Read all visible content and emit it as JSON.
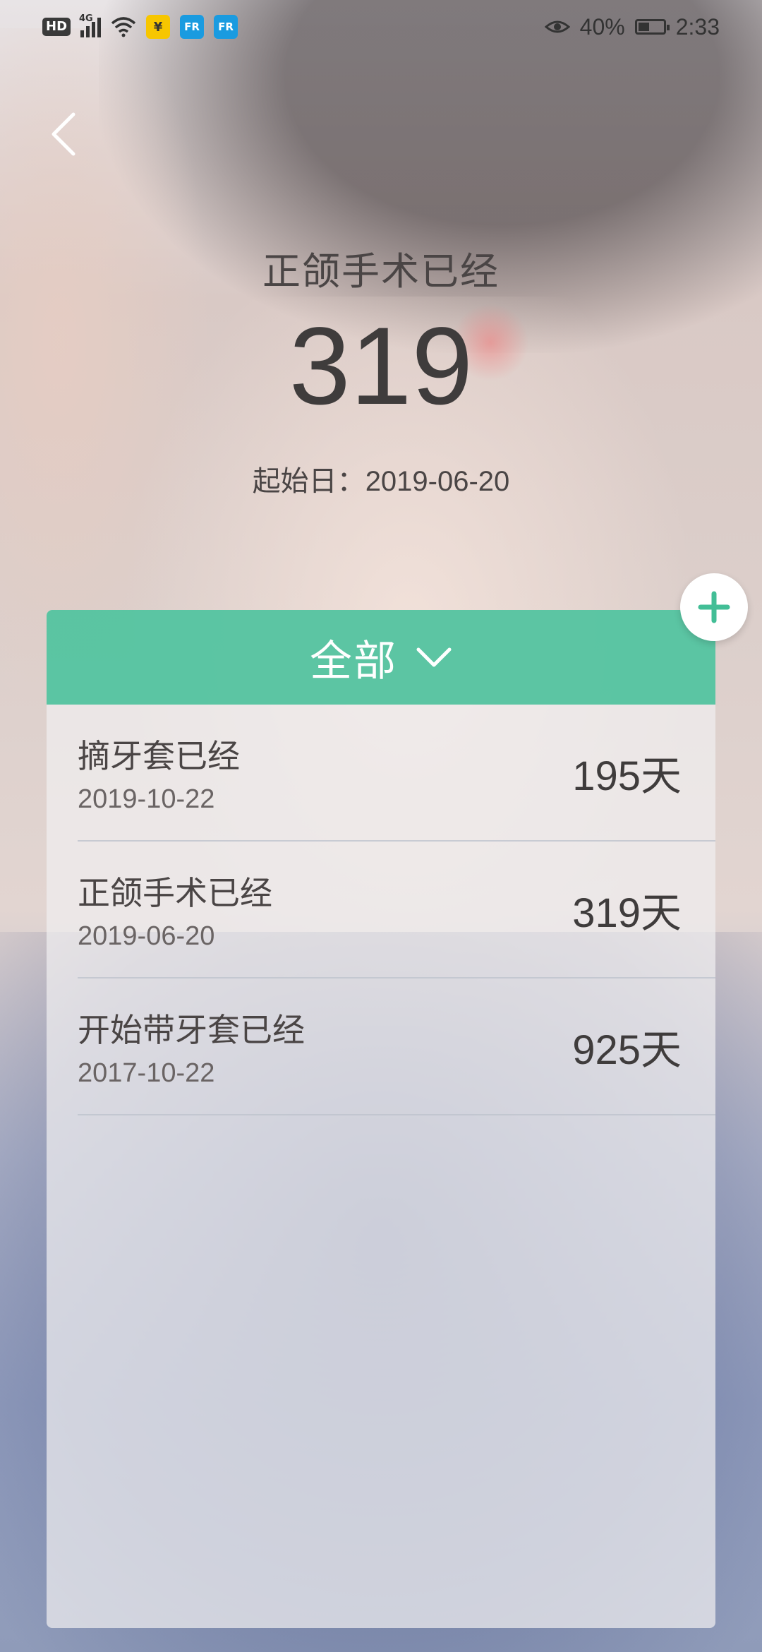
{
  "status_bar": {
    "hd": "HD",
    "network": "4G",
    "app_yen": "¥",
    "app_fr1": "FR",
    "app_fr2": "FR",
    "battery": "40%",
    "time": "2:33"
  },
  "hero": {
    "title": "正颌手术已经",
    "count": "319",
    "start_label": "起始日：",
    "start_date": "2019-06-20"
  },
  "filter": {
    "label": "全部"
  },
  "events": [
    {
      "title": "摘牙套已经",
      "date": "2019-10-22",
      "days": "195",
      "unit": "天"
    },
    {
      "title": "正颌手术已经",
      "date": "2019-06-20",
      "days": "319",
      "unit": "天"
    },
    {
      "title": "开始带牙套已经",
      "date": "2017-10-22",
      "days": "925",
      "unit": "天"
    }
  ],
  "colors": {
    "accent": "#42be96",
    "text_dark": "#3f3c3c",
    "text_muted": "#6a6464"
  },
  "icons": {
    "back": "back-arrow-icon",
    "add": "plus-icon",
    "dropdown": "chevron-down-icon"
  }
}
